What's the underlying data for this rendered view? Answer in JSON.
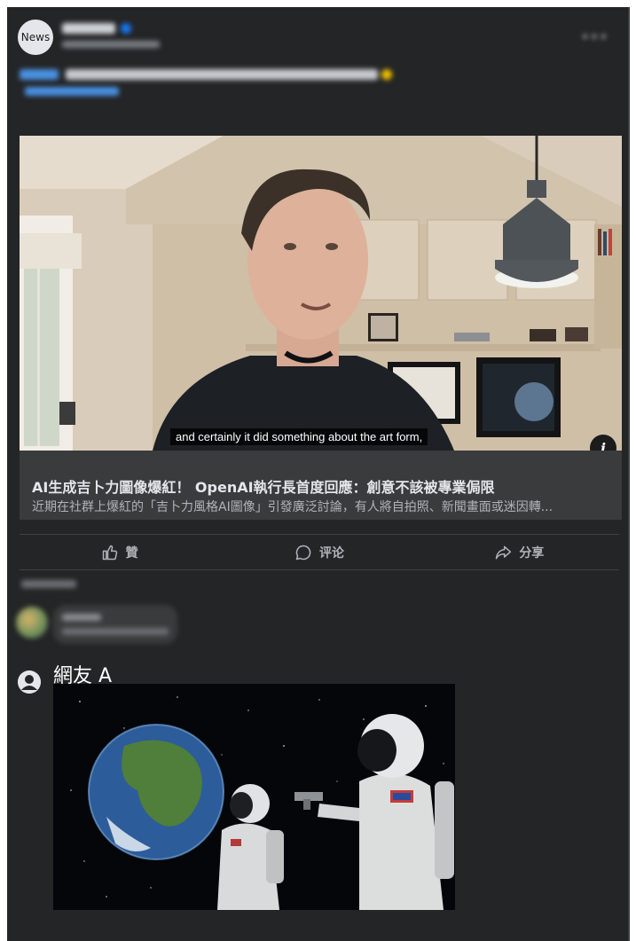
{
  "post": {
    "avatar_text": "News",
    "more_icon": "more-horizontal-icon"
  },
  "link_card": {
    "video_caption": "and certainly it did something about the art form,",
    "info_icon": "info-icon",
    "info_label": "i",
    "title": "AI生成吉卜力圖像爆紅！ OpenAI執行長首度回應：創意不該被專業侷限",
    "description": "近期在社群上爆紅的「吉卜力風格AI圖像」引發廣泛討論，有人將自拍照、新聞畫面或迷因轉..."
  },
  "actions": [
    {
      "label": "贊",
      "icon": "thumbs-up-icon"
    },
    {
      "label": "评论",
      "icon": "comment-icon"
    },
    {
      "label": "分享",
      "icon": "share-icon"
    }
  ],
  "comment": {
    "user_name": "網友 A",
    "avatar_icon": "user-avatar-icon"
  },
  "colors": {
    "post_background": "#242526",
    "card_background": "#3a3b3c",
    "text_primary": "#e4e6eb",
    "text_secondary": "#b0b3b8"
  }
}
